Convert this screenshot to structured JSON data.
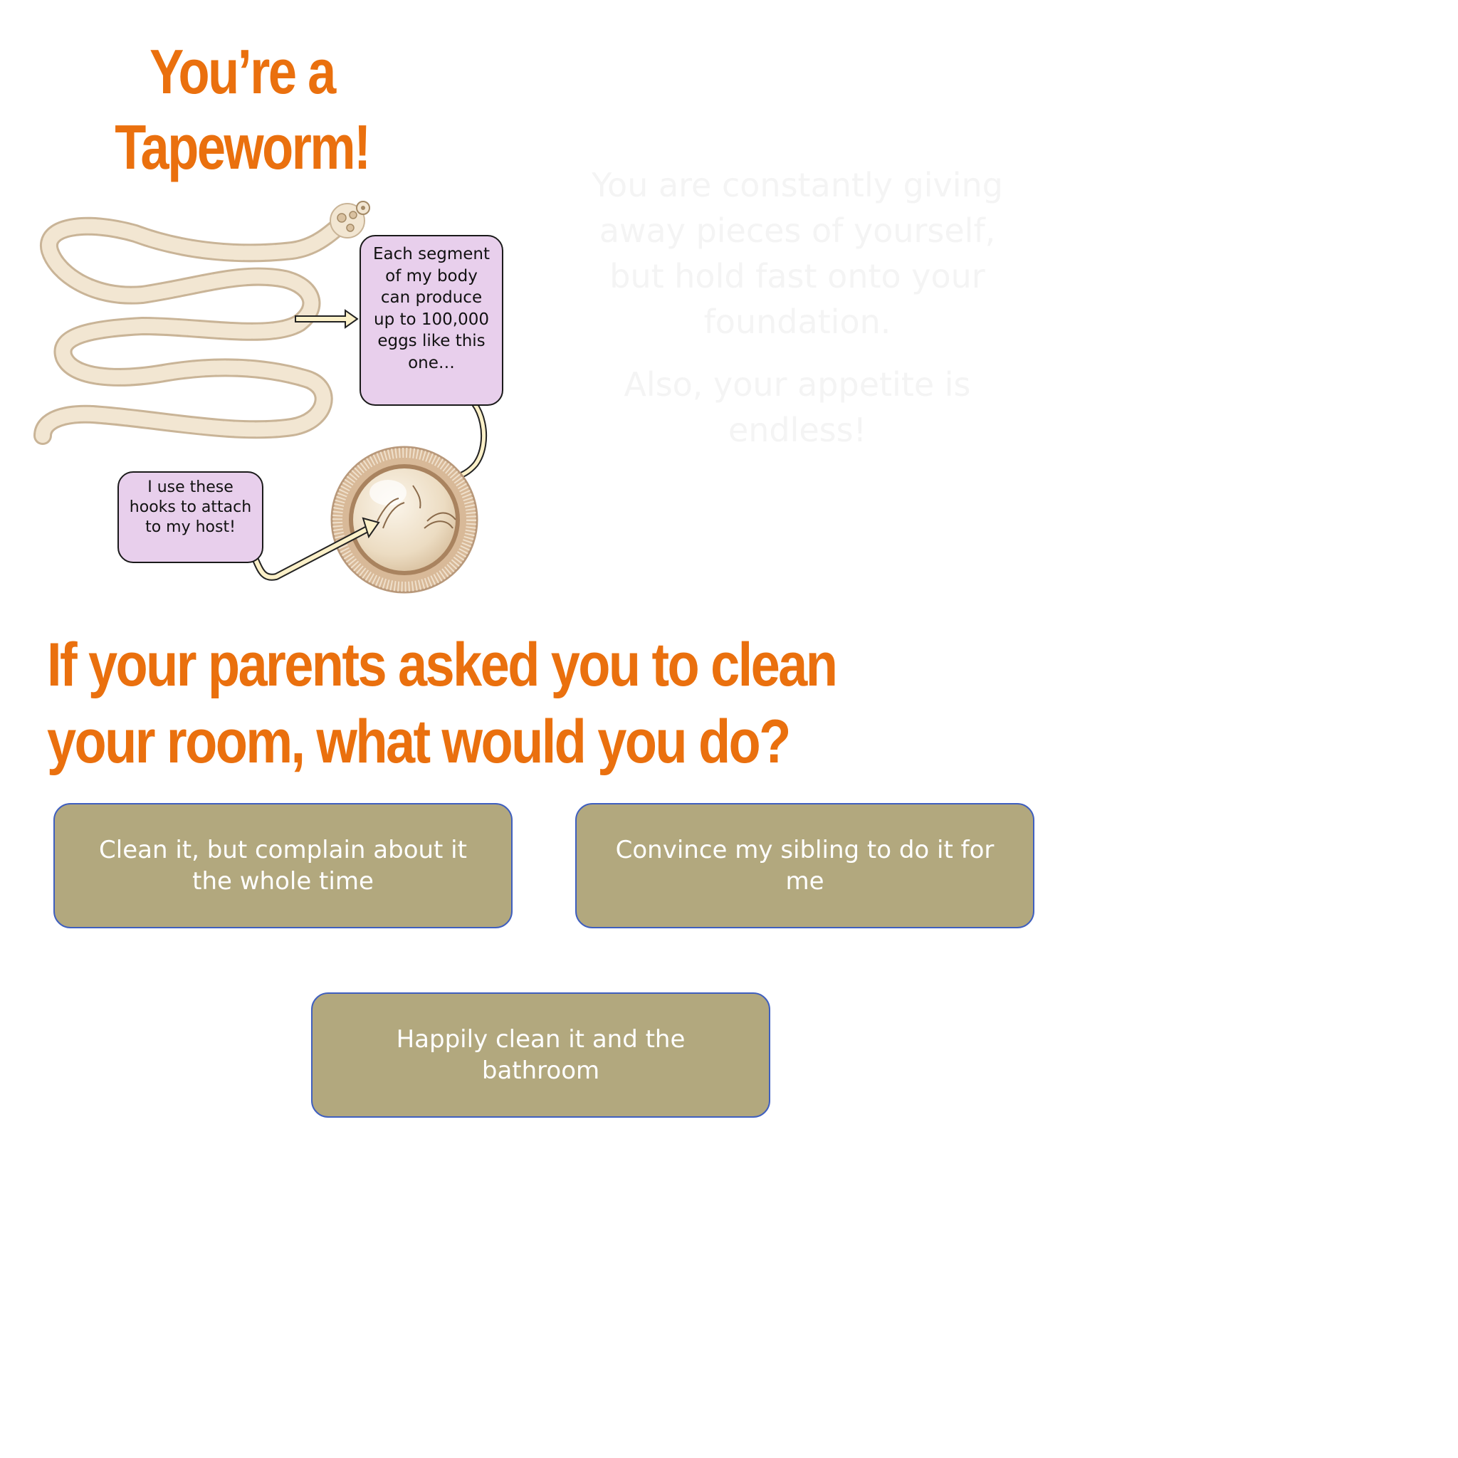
{
  "result": {
    "title_line1": "You’re a",
    "title_line2": "Tapeworm!"
  },
  "callouts": {
    "segment_text": "Each segment of my body can produce up to 100,000 eggs like this one…",
    "hooks_text": "I use these hooks to attach to my host!"
  },
  "description": {
    "paragraph1": "You are constantly giving away pieces of yourself, but hold fast onto your foundation.",
    "paragraph2": "Also, your appetite is endless!"
  },
  "question": {
    "text": "If your parents asked you to clean your room, what would you do?"
  },
  "choices": [
    {
      "label": "Clean it, but complain about it the whole time"
    },
    {
      "label": "Convince my sibling to do it for me"
    },
    {
      "label": "Happily clean it and the bathroom"
    }
  ],
  "colors": {
    "accent_orange": "#ea700e",
    "button_fill": "#b2a87e",
    "button_border": "#3f5fbf",
    "callout_fill": "#e8cfec"
  }
}
